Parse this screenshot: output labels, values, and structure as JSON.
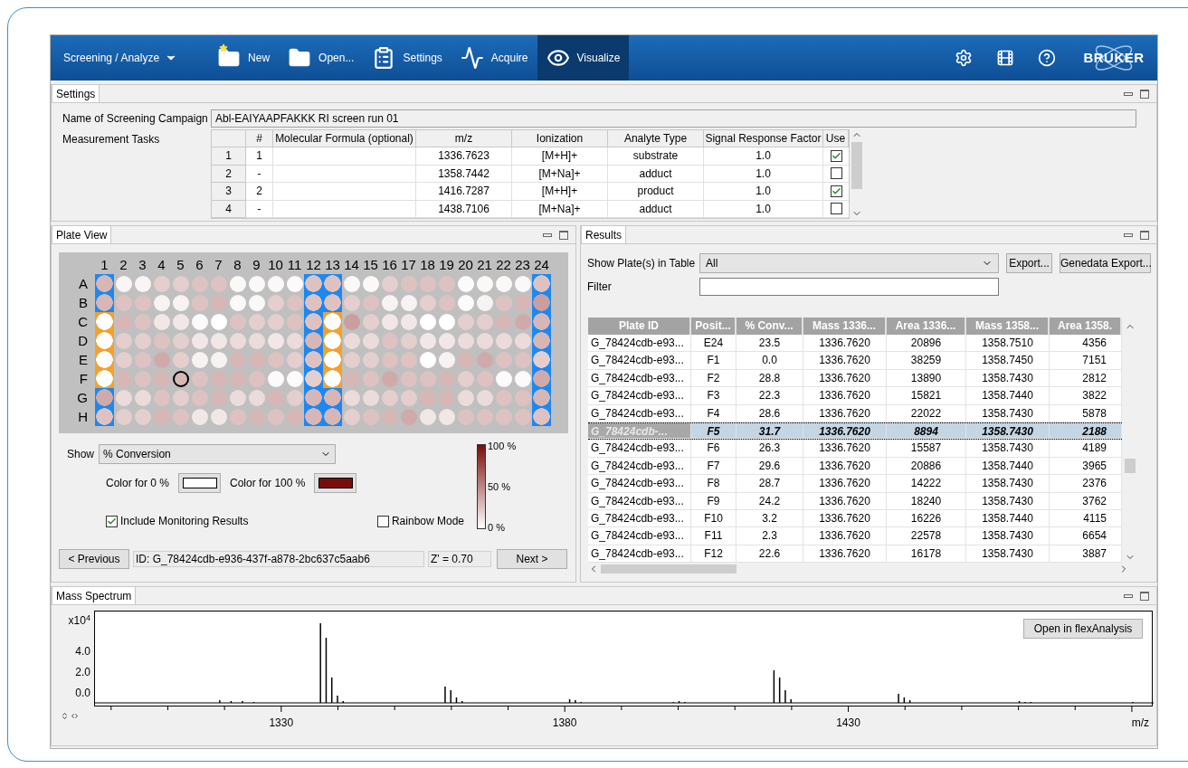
{
  "toolbar": {
    "perspective": "Screening / Analyze",
    "buttons": [
      {
        "kind": "new",
        "label": "New",
        "selected": false
      },
      {
        "kind": "open",
        "label": "Open...",
        "selected": false
      },
      {
        "kind": "settings",
        "label": "Settings",
        "selected": false
      },
      {
        "kind": "acquire",
        "label": "Acquire",
        "selected": false
      },
      {
        "kind": "visualize",
        "label": "Visualize",
        "selected": true
      }
    ],
    "logo": "BRUKER"
  },
  "settings": {
    "tab": "Settings",
    "campaign_label": "Name of Screening Campaign",
    "campaign_value": "Abl-EAIYAAPFAKKK RI screen run 01",
    "tasks_label": "Measurement Tasks",
    "columns": [
      "#",
      "Molecular Formula (optional)",
      "m/z",
      "Ionization",
      "Analyte Type",
      "Signal Response Factor",
      "Use"
    ],
    "rows": [
      {
        "index": "1",
        "number": "1",
        "mz": "1336.7623",
        "ionization": "[M+H]+",
        "analyte_type": "substrate",
        "factor": "1.0",
        "use": true
      },
      {
        "index": "2",
        "number": "-",
        "mz": "1358.7442",
        "ionization": "[M+Na]+",
        "analyte_type": "adduct",
        "factor": "1.0",
        "use": false
      },
      {
        "index": "3",
        "number": "2",
        "mz": "1416.7287",
        "ionization": "[M+H]+",
        "analyte_type": "product",
        "factor": "1.0",
        "use": true
      },
      {
        "index": "4",
        "number": "-",
        "mz": "1438.7106",
        "ionization": "[M+Na]+",
        "analyte_type": "adduct",
        "factor": "1.0",
        "use": false
      }
    ]
  },
  "plate_view": {
    "tab": "Plate View",
    "columns": [
      "1",
      "2",
      "3",
      "4",
      "5",
      "6",
      "7",
      "8",
      "9",
      "10",
      "11",
      "12",
      "13",
      "14",
      "15",
      "16",
      "17",
      "18",
      "19",
      "20",
      "21",
      "22",
      "23",
      "24"
    ],
    "rows": [
      {
        "label": "A",
        "wells": [
          {
            "kind": "control",
            "color": "#d7b6b6",
            "selected": false
          },
          {
            "kind": "sample",
            "color": "#faf5f5",
            "selected": false
          },
          {
            "kind": "sample",
            "color": "#faf5f5",
            "selected": false
          },
          {
            "kind": "sample",
            "color": "#e4cece",
            "selected": false
          },
          {
            "kind": "sample",
            "color": "#e4cece",
            "selected": false
          },
          {
            "kind": "sample",
            "color": "#dec2c2",
            "selected": false
          },
          {
            "kind": "sample",
            "color": "#dec2c2",
            "selected": false
          },
          {
            "kind": "sample",
            "color": "#fbf8f8",
            "selected": false
          },
          {
            "kind": "sample",
            "color": "#fbf8f8",
            "selected": false
          },
          {
            "kind": "sample",
            "color": "#fbf8f8",
            "selected": false
          },
          {
            "kind": "sample",
            "color": "#fcfafa",
            "selected": false
          },
          {
            "kind": "control",
            "color": "#dec2c2",
            "selected": false
          },
          {
            "kind": "control",
            "color": "#dec2c2",
            "selected": false
          },
          {
            "kind": "sample",
            "color": "#fbf8f8",
            "selected": false
          },
          {
            "kind": "sample",
            "color": "#fbf8f8",
            "selected": false
          },
          {
            "kind": "sample",
            "color": "#e4cece",
            "selected": false
          },
          {
            "kind": "sample",
            "color": "#dec2c2",
            "selected": false
          },
          {
            "kind": "sample",
            "color": "#dec2c2",
            "selected": false
          },
          {
            "kind": "sample",
            "color": "#dec2c2",
            "selected": false
          },
          {
            "kind": "sample",
            "color": "#fcfafa",
            "selected": false
          },
          {
            "kind": "sample",
            "color": "#fbf8f8",
            "selected": false
          },
          {
            "kind": "sample",
            "color": "#fbf8f8",
            "selected": false
          },
          {
            "kind": "sample",
            "color": "#fbf8f8",
            "selected": false
          },
          {
            "kind": "control",
            "color": "#dec2c2",
            "selected": false
          }
        ]
      },
      {
        "label": "B",
        "wells": [
          {
            "kind": "control",
            "color": "#d7b6b6",
            "selected": false
          },
          {
            "kind": "sample",
            "color": "#dec2c2",
            "selected": false
          },
          {
            "kind": "sample",
            "color": "#dec2c2",
            "selected": false
          },
          {
            "kind": "sample",
            "color": "#f8f3f3",
            "selected": false
          },
          {
            "kind": "sample",
            "color": "#f8f3f3",
            "selected": false
          },
          {
            "kind": "sample",
            "color": "#dec2c2",
            "selected": false
          },
          {
            "kind": "sample",
            "color": "#d7b6b6",
            "selected": false
          },
          {
            "kind": "sample",
            "color": "#fbf8f8",
            "selected": false
          },
          {
            "kind": "sample",
            "color": "#fbf8f8",
            "selected": false
          },
          {
            "kind": "sample",
            "color": "#e4cece",
            "selected": false
          },
          {
            "kind": "sample",
            "color": "#dec2c2",
            "selected": false
          },
          {
            "kind": "control",
            "color": "#dec2c2",
            "selected": false
          },
          {
            "kind": "control",
            "color": "#dec2c2",
            "selected": false
          },
          {
            "kind": "sample",
            "color": "#e4cece",
            "selected": false
          },
          {
            "kind": "sample",
            "color": "#dec2c2",
            "selected": false
          },
          {
            "kind": "sample",
            "color": "#f8f3f3",
            "selected": false
          },
          {
            "kind": "sample",
            "color": "#f8f3f3",
            "selected": false
          },
          {
            "kind": "sample",
            "color": "#e4cece",
            "selected": false
          },
          {
            "kind": "sample",
            "color": "#dec2c2",
            "selected": false
          },
          {
            "kind": "sample",
            "color": "#fcfafa",
            "selected": false
          },
          {
            "kind": "sample",
            "color": "#f8f3f3",
            "selected": false
          },
          {
            "kind": "sample",
            "color": "#dec2c2",
            "selected": false
          },
          {
            "kind": "sample",
            "color": "#d7b6b6",
            "selected": false
          },
          {
            "kind": "control",
            "color": "#ca9e9e",
            "selected": false
          }
        ]
      },
      {
        "label": "C",
        "wells": [
          {
            "kind": "monitor",
            "color": "#ffffff",
            "selected": false
          },
          {
            "kind": "sample",
            "color": "#d7b6b6",
            "selected": false
          },
          {
            "kind": "sample",
            "color": "#dec2c2",
            "selected": false
          },
          {
            "kind": "sample",
            "color": "#f2e7e7",
            "selected": false
          },
          {
            "kind": "sample",
            "color": "#f2e7e7",
            "selected": false
          },
          {
            "kind": "sample",
            "color": "#fcfafa",
            "selected": false
          },
          {
            "kind": "sample",
            "color": "#ffffff",
            "selected": false
          },
          {
            "kind": "sample",
            "color": "#dec2c2",
            "selected": false
          },
          {
            "kind": "sample",
            "color": "#e4cece",
            "selected": false
          },
          {
            "kind": "sample",
            "color": "#e4cece",
            "selected": false
          },
          {
            "kind": "sample",
            "color": "#dec2c2",
            "selected": false
          },
          {
            "kind": "control",
            "color": "#dec2c2",
            "selected": false
          },
          {
            "kind": "monitor",
            "color": "#ffffff",
            "selected": false
          },
          {
            "kind": "sample",
            "color": "#ca9e9e",
            "selected": false
          },
          {
            "kind": "sample",
            "color": "#e4cece",
            "selected": false
          },
          {
            "kind": "sample",
            "color": "#f2e7e7",
            "selected": false
          },
          {
            "kind": "sample",
            "color": "#f2e7e7",
            "selected": false
          },
          {
            "kind": "sample",
            "color": "#ffffff",
            "selected": false
          },
          {
            "kind": "sample",
            "color": "#ffffff",
            "selected": false
          },
          {
            "kind": "sample",
            "color": "#e4cece",
            "selected": false
          },
          {
            "kind": "sample",
            "color": "#e4cece",
            "selected": false
          },
          {
            "kind": "sample",
            "color": "#d7b6b6",
            "selected": false
          },
          {
            "kind": "sample",
            "color": "#d0aaaa",
            "selected": false
          },
          {
            "kind": "control",
            "color": "#d7b6b6",
            "selected": false
          }
        ]
      },
      {
        "label": "D",
        "wells": [
          {
            "kind": "monitor",
            "color": "#ffffff",
            "selected": false
          },
          {
            "kind": "sample",
            "color": "#e4cece",
            "selected": false
          },
          {
            "kind": "sample",
            "color": "#e4cece",
            "selected": false
          },
          {
            "kind": "sample",
            "color": "#dec2c2",
            "selected": false
          },
          {
            "kind": "sample",
            "color": "#e4cece",
            "selected": false
          },
          {
            "kind": "sample",
            "color": "#f2e7e7",
            "selected": false
          },
          {
            "kind": "sample",
            "color": "#f2e7e7",
            "selected": false
          },
          {
            "kind": "sample",
            "color": "#ebdbdb",
            "selected": false
          },
          {
            "kind": "sample",
            "color": "#ebdbdb",
            "selected": false
          },
          {
            "kind": "sample",
            "color": "#f2e7e7",
            "selected": false
          },
          {
            "kind": "sample",
            "color": "#ebdbdb",
            "selected": false
          },
          {
            "kind": "control",
            "color": "#d7b6b6",
            "selected": false
          },
          {
            "kind": "monitor",
            "color": "#ffffff",
            "selected": false
          },
          {
            "kind": "sample",
            "color": "#ebdbdb",
            "selected": false
          },
          {
            "kind": "sample",
            "color": "#ebdbdb",
            "selected": false
          },
          {
            "kind": "sample",
            "color": "#dec2c2",
            "selected": false
          },
          {
            "kind": "sample",
            "color": "#e4cece",
            "selected": false
          },
          {
            "kind": "sample",
            "color": "#f2e7e7",
            "selected": false
          },
          {
            "kind": "sample",
            "color": "#f2e7e7",
            "selected": false
          },
          {
            "kind": "sample",
            "color": "#ebdbdb",
            "selected": false
          },
          {
            "kind": "sample",
            "color": "#ebdbdb",
            "selected": false
          },
          {
            "kind": "sample",
            "color": "#ebdbdb",
            "selected": false
          },
          {
            "kind": "sample",
            "color": "#ebdbdb",
            "selected": false
          },
          {
            "kind": "control",
            "color": "#d7b6b6",
            "selected": false
          }
        ]
      },
      {
        "label": "E",
        "wells": [
          {
            "kind": "monitor",
            "color": "#ffffff",
            "selected": false
          },
          {
            "kind": "sample",
            "color": "#e4cece",
            "selected": false
          },
          {
            "kind": "sample",
            "color": "#dec2c2",
            "selected": false
          },
          {
            "kind": "sample",
            "color": "#d0aaaa",
            "selected": false
          },
          {
            "kind": "sample",
            "color": "#e4cece",
            "selected": false
          },
          {
            "kind": "sample",
            "color": "#f8f3f3",
            "selected": false
          },
          {
            "kind": "sample",
            "color": "#f8f3f3",
            "selected": false
          },
          {
            "kind": "sample",
            "color": "#d7b6b6",
            "selected": false
          },
          {
            "kind": "sample",
            "color": "#d7b6b6",
            "selected": false
          },
          {
            "kind": "sample",
            "color": "#dec2c2",
            "selected": false
          },
          {
            "kind": "sample",
            "color": "#e4cece",
            "selected": false
          },
          {
            "kind": "control",
            "color": "#dec2c2",
            "selected": false
          },
          {
            "kind": "monitor",
            "color": "#ffffff",
            "selected": false
          },
          {
            "kind": "sample",
            "color": "#e4cece",
            "selected": false
          },
          {
            "kind": "sample",
            "color": "#e4cece",
            "selected": false
          },
          {
            "kind": "sample",
            "color": "#dec2c2",
            "selected": false
          },
          {
            "kind": "sample",
            "color": "#dec2c2",
            "selected": false
          },
          {
            "kind": "sample",
            "color": "#ffffff",
            "selected": false
          },
          {
            "kind": "sample",
            "color": "#f8f3f3",
            "selected": false
          },
          {
            "kind": "sample",
            "color": "#d7b6b6",
            "selected": false
          },
          {
            "kind": "sample",
            "color": "#d0aaaa",
            "selected": false
          },
          {
            "kind": "sample",
            "color": "#dec2c2",
            "selected": false
          },
          {
            "kind": "sample",
            "color": "#dec2c2",
            "selected": false
          },
          {
            "kind": "control",
            "color": "#e4cece",
            "selected": false
          }
        ]
      },
      {
        "label": "F",
        "wells": [
          {
            "kind": "monitor",
            "color": "#ffffff",
            "selected": false
          },
          {
            "kind": "sample",
            "color": "#d7b6b6",
            "selected": false
          },
          {
            "kind": "sample",
            "color": "#dec2c2",
            "selected": false
          },
          {
            "kind": "sample",
            "color": "#d7b6b6",
            "selected": false
          },
          {
            "kind": "sample",
            "color": "#d7b6b6",
            "selected": true
          },
          {
            "kind": "sample",
            "color": "#dec2c2",
            "selected": false
          },
          {
            "kind": "sample",
            "color": "#d7b6b6",
            "selected": false
          },
          {
            "kind": "sample",
            "color": "#d7b6b6",
            "selected": false
          },
          {
            "kind": "sample",
            "color": "#dec2c2",
            "selected": false
          },
          {
            "kind": "sample",
            "color": "#fcfafa",
            "selected": false
          },
          {
            "kind": "sample",
            "color": "#fcfafa",
            "selected": false
          },
          {
            "kind": "control",
            "color": "#e4cece",
            "selected": false
          },
          {
            "kind": "monitor",
            "color": "#ffffff",
            "selected": false
          },
          {
            "kind": "sample",
            "color": "#d7b6b6",
            "selected": false
          },
          {
            "kind": "sample",
            "color": "#dec2c2",
            "selected": false
          },
          {
            "kind": "sample",
            "color": "#d0aaaa",
            "selected": false
          },
          {
            "kind": "sample",
            "color": "#dec2c2",
            "selected": false
          },
          {
            "kind": "sample",
            "color": "#dec2c2",
            "selected": false
          },
          {
            "kind": "sample",
            "color": "#d7b6b6",
            "selected": false
          },
          {
            "kind": "sample",
            "color": "#e4cece",
            "selected": false
          },
          {
            "kind": "sample",
            "color": "#dec2c2",
            "selected": false
          },
          {
            "kind": "sample",
            "color": "#fcfafa",
            "selected": false
          },
          {
            "kind": "sample",
            "color": "#fcfafa",
            "selected": false
          },
          {
            "kind": "control",
            "color": "#d0aaaa",
            "selected": false
          }
        ]
      },
      {
        "label": "G",
        "wells": [
          {
            "kind": "control",
            "color": "#d0aaaa",
            "selected": false
          },
          {
            "kind": "sample",
            "color": "#ebdbdb",
            "selected": false
          },
          {
            "kind": "sample",
            "color": "#ebdbdb",
            "selected": false
          },
          {
            "kind": "sample",
            "color": "#dec2c2",
            "selected": false
          },
          {
            "kind": "sample",
            "color": "#e4cece",
            "selected": false
          },
          {
            "kind": "sample",
            "color": "#dec2c2",
            "selected": false
          },
          {
            "kind": "sample",
            "color": "#d7b6b6",
            "selected": false
          },
          {
            "kind": "sample",
            "color": "#ebdbdb",
            "selected": false
          },
          {
            "kind": "sample",
            "color": "#ebdbdb",
            "selected": false
          },
          {
            "kind": "sample",
            "color": "#d7b6b6",
            "selected": false
          },
          {
            "kind": "sample",
            "color": "#e4cece",
            "selected": false
          },
          {
            "kind": "control",
            "color": "#d7b6b6",
            "selected": false
          },
          {
            "kind": "control",
            "color": "#d7b6b6",
            "selected": false
          },
          {
            "kind": "sample",
            "color": "#ebdbdb",
            "selected": false
          },
          {
            "kind": "sample",
            "color": "#ebdbdb",
            "selected": false
          },
          {
            "kind": "sample",
            "color": "#e4cece",
            "selected": false
          },
          {
            "kind": "sample",
            "color": "#e4cece",
            "selected": false
          },
          {
            "kind": "sample",
            "color": "#d7b6b6",
            "selected": false
          },
          {
            "kind": "sample",
            "color": "#d7b6b6",
            "selected": false
          },
          {
            "kind": "sample",
            "color": "#ebdbdb",
            "selected": false
          },
          {
            "kind": "sample",
            "color": "#ebdbdb",
            "selected": false
          },
          {
            "kind": "sample",
            "color": "#dec2c2",
            "selected": false
          },
          {
            "kind": "sample",
            "color": "#dec2c2",
            "selected": false
          },
          {
            "kind": "control",
            "color": "#d7b6b6",
            "selected": false
          }
        ]
      },
      {
        "label": "H",
        "wells": [
          {
            "kind": "control",
            "color": "#dec2c2",
            "selected": false
          },
          {
            "kind": "sample",
            "color": "#e4cece",
            "selected": false
          },
          {
            "kind": "sample",
            "color": "#e4cece",
            "selected": false
          },
          {
            "kind": "sample",
            "color": "#d7b6b6",
            "selected": false
          },
          {
            "kind": "sample",
            "color": "#dec2c2",
            "selected": false
          },
          {
            "kind": "sample",
            "color": "#f2e7e7",
            "selected": false
          },
          {
            "kind": "sample",
            "color": "#f2e7e7",
            "selected": false
          },
          {
            "kind": "sample",
            "color": "#dec2c2",
            "selected": false
          },
          {
            "kind": "sample",
            "color": "#d7b6b6",
            "selected": false
          },
          {
            "kind": "sample",
            "color": "#dec2c2",
            "selected": false
          },
          {
            "kind": "sample",
            "color": "#d7b6b6",
            "selected": false
          },
          {
            "kind": "control",
            "color": "#d7b6b6",
            "selected": false
          },
          {
            "kind": "control",
            "color": "#d7b6b6",
            "selected": false
          },
          {
            "kind": "sample",
            "color": "#e4cece",
            "selected": false
          },
          {
            "kind": "sample",
            "color": "#dec2c2",
            "selected": false
          },
          {
            "kind": "sample",
            "color": "#d7b6b6",
            "selected": false
          },
          {
            "kind": "sample",
            "color": "#d0aaaa",
            "selected": false
          },
          {
            "kind": "sample",
            "color": "#f2e7e7",
            "selected": false
          },
          {
            "kind": "sample",
            "color": "#f2e7e7",
            "selected": false
          },
          {
            "kind": "sample",
            "color": "#dec2c2",
            "selected": false
          },
          {
            "kind": "sample",
            "color": "#dec2c2",
            "selected": false
          },
          {
            "kind": "sample",
            "color": "#dec2c2",
            "selected": false
          },
          {
            "kind": "sample",
            "color": "#dec2c2",
            "selected": false
          },
          {
            "kind": "control",
            "color": "#dec2c2",
            "selected": false
          }
        ]
      }
    ],
    "show_label": "Show",
    "show_value": "% Conversion",
    "color_0": {
      "label": "Color for 0 %",
      "color": "#ffffff"
    },
    "color_100": {
      "label": "Color for 100 %",
      "color": "#7a0c0c"
    },
    "legend": [
      "100 %",
      "50 %",
      "0 %"
    ],
    "include_monitoring": {
      "label": "Include Monitoring Results",
      "checked": true
    },
    "rainbow_mode": {
      "label": "Rainbow Mode",
      "checked": false
    },
    "previous": "< Previous",
    "id": "ID: G_78424cdb-e936-437f-a878-2bc637c5aab6",
    "z_prime": "Z' = 0.70",
    "next": "Next >"
  },
  "results": {
    "tab": "Results",
    "show_label": "Show Plate(s) in Table",
    "show_value": "All",
    "export": "Export...",
    "genedata_export": "Genedata Export...",
    "filter_label": "Filter",
    "columns": [
      "Plate ID",
      "Posit...",
      "% Conv...",
      "Mass 1336...",
      "Area 1336...",
      "Mass 1358...",
      "Area 1358."
    ],
    "rows": [
      {
        "cells": [
          "G_78424cdb-e93...",
          "E24",
          "23.5",
          "1336.7620",
          "20896",
          "1358.7510",
          "4356"
        ],
        "selected": false
      },
      {
        "cells": [
          "G_78424cdb-e93...",
          "F1",
          "0.0",
          "1336.7620",
          "38259",
          "1358.7450",
          "7151"
        ],
        "selected": false
      },
      {
        "cells": [
          "G_78424cdb-e93...",
          "F2",
          "28.8",
          "1336.7620",
          "13890",
          "1358.7430",
          "2812"
        ],
        "selected": false
      },
      {
        "cells": [
          "G_78424cdb-e93...",
          "F3",
          "22.3",
          "1336.7620",
          "15821",
          "1358.7440",
          "3822"
        ],
        "selected": false
      },
      {
        "cells": [
          "G_78424cdb-e93...",
          "F4",
          "28.6",
          "1336.7620",
          "22022",
          "1358.7430",
          "5878"
        ],
        "selected": false
      },
      {
        "cells": [
          "G_78424cdb-...",
          "F5",
          "31.7",
          "1336.7620",
          "8894",
          "1358.7430",
          "2188"
        ],
        "selected": true
      },
      {
        "cells": [
          "G_78424cdb-e93...",
          "F6",
          "26.3",
          "1336.7620",
          "15587",
          "1358.7430",
          "4189"
        ],
        "selected": false
      },
      {
        "cells": [
          "G_78424cdb-e93...",
          "F7",
          "29.6",
          "1336.7620",
          "20886",
          "1358.7440",
          "3965"
        ],
        "selected": false
      },
      {
        "cells": [
          "G_78424cdb-e93...",
          "F8",
          "28.7",
          "1336.7620",
          "14222",
          "1358.7430",
          "2376"
        ],
        "selected": false
      },
      {
        "cells": [
          "G_78424cdb-e93...",
          "F9",
          "24.2",
          "1336.7620",
          "18240",
          "1358.7430",
          "3762"
        ],
        "selected": false
      },
      {
        "cells": [
          "G_78424cdb-e93...",
          "F10",
          "3.2",
          "1336.7620",
          "16226",
          "1358.7440",
          "4115"
        ],
        "selected": false
      },
      {
        "cells": [
          "G_78424cdb-e93...",
          "F11",
          "2.3",
          "1336.7620",
          "22578",
          "1358.7430",
          "6654"
        ],
        "selected": false
      },
      {
        "cells": [
          "G_78424cdb-e93...",
          "F12",
          "22.6",
          "1336.7620",
          "16178",
          "1358.7430",
          "3887"
        ],
        "selected": false
      }
    ]
  },
  "mass_spectrum": {
    "tab": "Mass Spectrum",
    "y_scale": "x10$^{4}$",
    "yticks": [
      "4.0",
      "2.0",
      "0.0"
    ],
    "xticks": [
      "1330",
      "1380",
      "1430"
    ],
    "xlabel": "m/z",
    "open_button": "Open in flexAnalysis"
  }
}
